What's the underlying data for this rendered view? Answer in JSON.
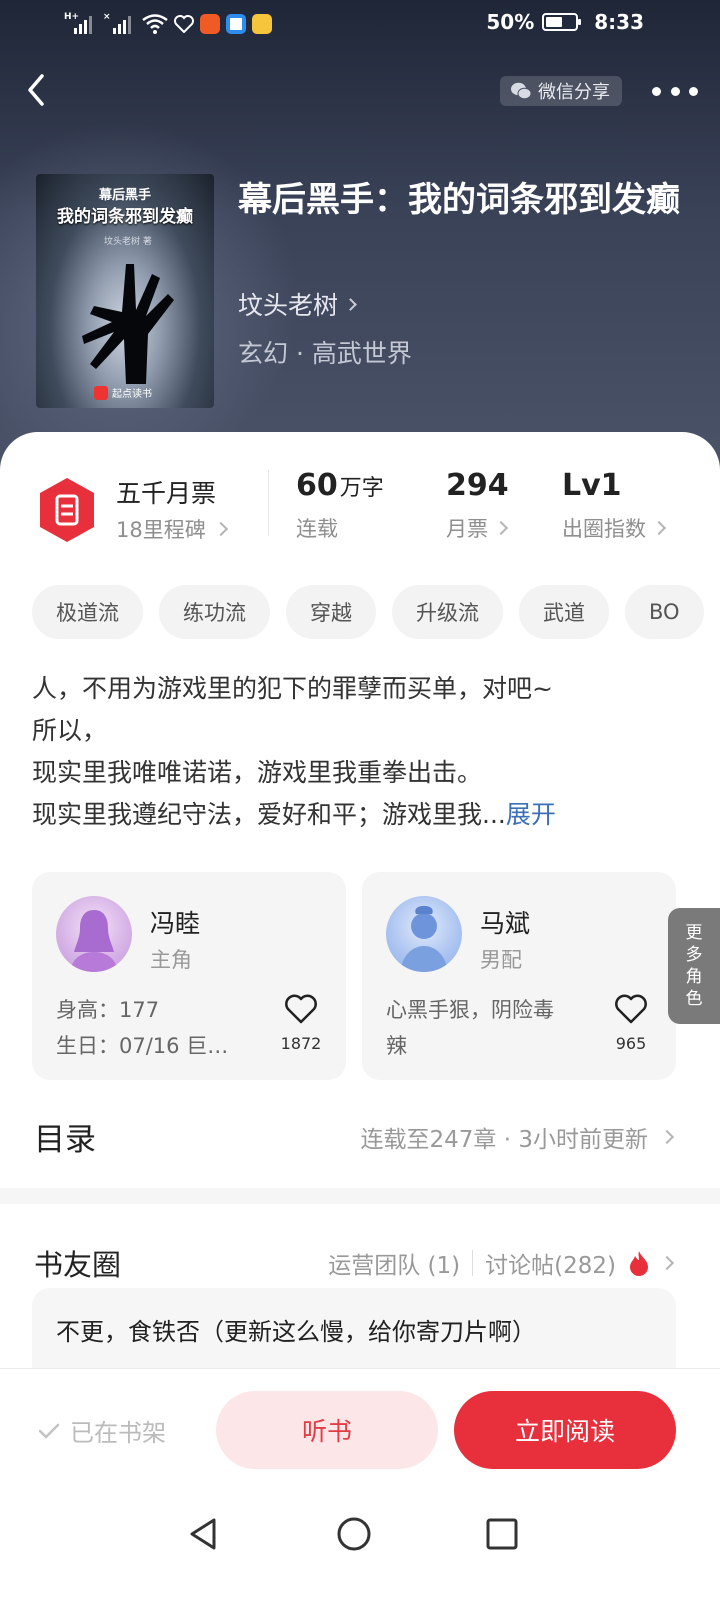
{
  "status_bar": {
    "network_label": "H+",
    "network_label_2": "×",
    "battery_percent": "50%",
    "time": "8:33"
  },
  "header": {
    "share_label": "微信分享"
  },
  "book": {
    "title": "幕后黑手：我的词条邪到发癫",
    "author": "坟头老树",
    "genre": "玄幻 · 高武世界",
    "cover": {
      "top_line": "幕后黑手",
      "main_line": "我的词条邪到发癫",
      "author_line": "坟头老树 著",
      "publisher": "起点读书"
    }
  },
  "stats": {
    "milestone_title": "五千月票",
    "milestone_sub": "18里程碑",
    "words_value": "60",
    "words_unit": "万字",
    "words_label": "连载",
    "votes_value": "294",
    "votes_label": "月票",
    "index_value": "Lv1",
    "index_label": "出圈指数"
  },
  "tags": [
    "极道流",
    "练功流",
    "穿越",
    "升级流",
    "武道",
    "BO"
  ],
  "synopsis": {
    "line1": "人，不用为游戏里的犯下的罪孽而买单，对吧~",
    "line2": "所以，",
    "line3": "现实里我唯唯诺诺，游戏里我重拳出击。",
    "line4": "现实里我遵纪守法，爱好和平；游戏里我...",
    "expand_label": "展开"
  },
  "characters": [
    {
      "name": "冯睦",
      "role": "主角",
      "desc_1": "身高：177",
      "desc_2": "生日：07/16 巨…",
      "likes": "1872"
    },
    {
      "name": "马斌",
      "role": "男配",
      "desc_1": "心黑手狠，阴险毒",
      "desc_2": "辣",
      "likes": "965"
    }
  ],
  "more_roles_label": [
    "更",
    "多",
    "角",
    "色"
  ],
  "catalog": {
    "title": "目录",
    "info": "连载至247章 · 3小时前更新"
  },
  "circle": {
    "title": "书友圈",
    "team": "运营团队 (1)",
    "posts": "讨论帖(282)",
    "preview": "不更，食铁否（更新这么慢，给你寄刀片啊）"
  },
  "actions": {
    "on_shelf": "已在书架",
    "listen": "听书",
    "read": "立即阅读"
  },
  "colors": {
    "accent": "#e8303c",
    "listen_bg": "#fde6e7",
    "link": "#3b6fb6"
  }
}
